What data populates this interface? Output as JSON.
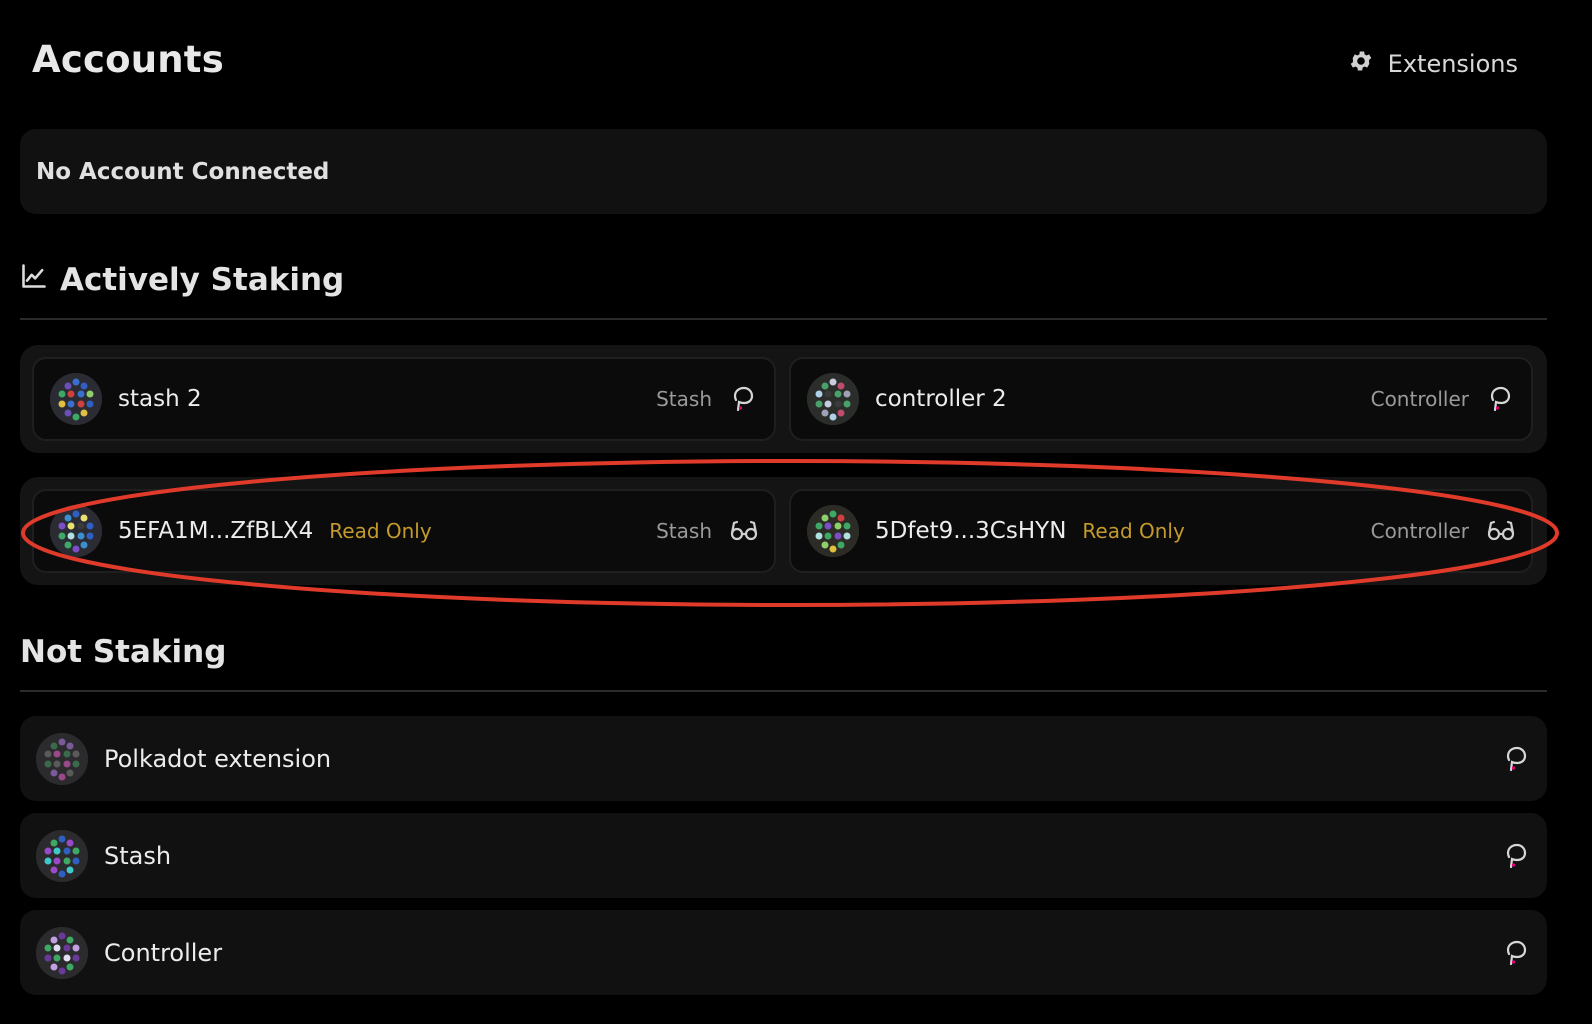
{
  "header": {
    "title": "Accounts",
    "extensions_label": "Extensions"
  },
  "connection": {
    "status_text": "No Account Connected"
  },
  "actively_staking": {
    "heading": "Actively Staking",
    "pairs": [
      {
        "stash": {
          "name": "stash 2",
          "role": "Stash",
          "icon": "polkadot-icon"
        },
        "controller": {
          "name": "controller 2",
          "role": "Controller",
          "icon": "polkadot-icon"
        }
      },
      {
        "stash": {
          "name": "5EFA1M...ZfBLX4",
          "badge": "Read Only",
          "role": "Stash",
          "icon": "glasses-icon"
        },
        "controller": {
          "name": "5Dfet9...3CsHYN",
          "badge": "Read Only",
          "role": "Controller",
          "icon": "glasses-icon"
        }
      }
    ]
  },
  "not_staking": {
    "heading": "Not Staking",
    "accounts": [
      {
        "name": "Polkadot extension",
        "icon": "polkadot-icon"
      },
      {
        "name": "Stash",
        "icon": "polkadot-icon"
      },
      {
        "name": "Controller",
        "icon": "polkadot-icon"
      }
    ]
  },
  "colors": {
    "background": "#000000",
    "card": "#111111",
    "read_only_badge": "#c39a2b",
    "highlight_ring": "#e03a2a",
    "polkadot_pink": "#e6007a"
  }
}
